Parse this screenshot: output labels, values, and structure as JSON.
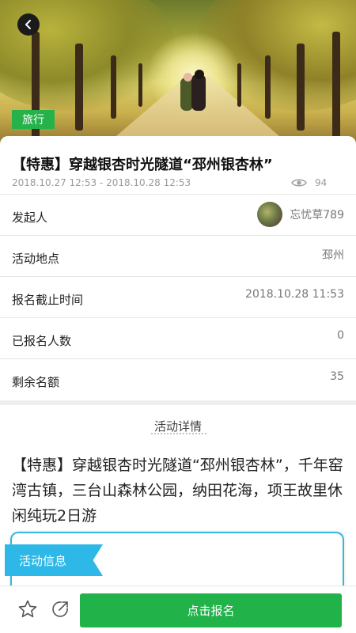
{
  "hero": {
    "tag": "旅行"
  },
  "event": {
    "title": "【特惠】穿越银杏时光隧道“邳州银杏林”",
    "time_range": "2018.10.27 12:53 - 2018.10.28 12:53",
    "views": "94"
  },
  "rows": {
    "host": {
      "label": "发起人",
      "name": "忘忧草789"
    },
    "location": {
      "label": "活动地点",
      "value": "邳州"
    },
    "deadline": {
      "label": "报名截止时间",
      "value": "2018.10.28 11:53"
    },
    "enrolled": {
      "label": "已报名人数",
      "value": "0"
    },
    "remaining": {
      "label": "剩余名额",
      "value": "35"
    }
  },
  "detail": {
    "heading": "活动详情",
    "description": "【特惠】穿越银杏时光隧道“邳州银杏林”，千年窑湾古镇，三台山森林公园，纳田花海，项王故里休闲纯玩2日游",
    "info_ribbon": "活动信息"
  },
  "actions": {
    "signup": "点击报名"
  },
  "colors": {
    "accent_green": "#22b24a",
    "ribbon_blue": "#2db8e8"
  },
  "icons": {
    "back": "back-arrow-icon",
    "views": "eye-icon",
    "favorite": "star-icon",
    "share": "share-icon"
  }
}
